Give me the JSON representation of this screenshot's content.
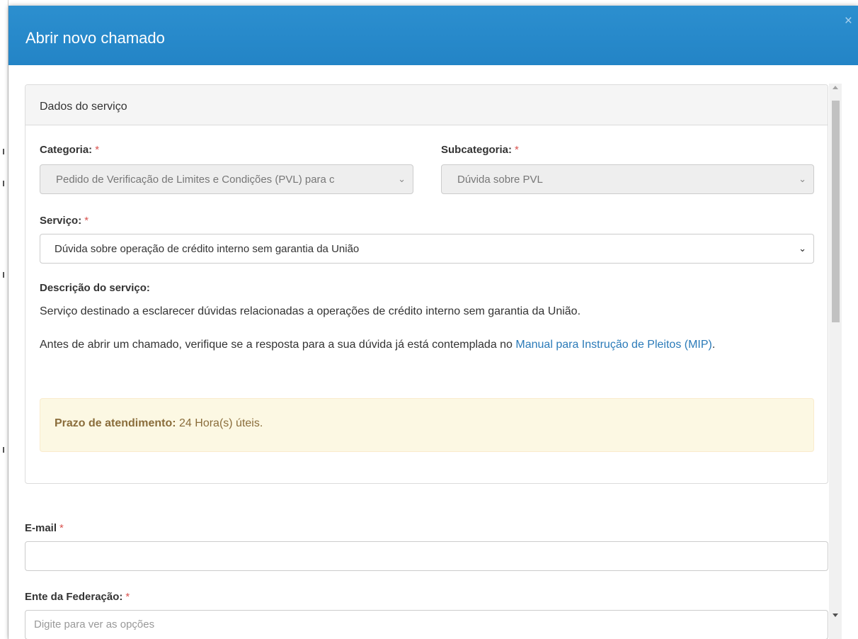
{
  "modal": {
    "title": "Abrir novo chamado",
    "close_symbol": "×"
  },
  "panel": {
    "heading": "Dados do serviço",
    "categoria": {
      "label": "Categoria:",
      "required_mark": "*",
      "value": "Pedido de Verificação de Limites e Condições (PVL) para c",
      "disabled": true
    },
    "subcategoria": {
      "label": "Subcategoria:",
      "required_mark": "*",
      "value": "Dúvida sobre PVL",
      "disabled": true
    },
    "servico": {
      "label": "Serviço:",
      "required_mark": "*",
      "value": "Dúvida sobre operação de crédito interno sem garantia da União"
    },
    "descricao": {
      "label": "Descrição do serviço:",
      "text": "Serviço destinado a esclarecer dúvidas relacionadas a operações de crédito interno sem garantia da União.",
      "note_before_link": "Antes de abrir um chamado, verifique se a resposta para a sua dúvida já está contemplada no ",
      "link_text": "Manual para Instrução de Pleitos (MIP)",
      "note_after_link": "."
    },
    "prazo": {
      "label": "Prazo de atendimento:",
      "value": "24 Hora(s) úteis."
    }
  },
  "email": {
    "label": "E-mail",
    "required_mark": "*",
    "value": ""
  },
  "ente": {
    "label": "Ente da Federação:",
    "required_mark": "*",
    "placeholder": "Digite para ver as opções"
  },
  "icons": {
    "close": "close-icon",
    "select_caret": "chevron-down-icon",
    "scroll_up": "scroll-up-arrow-icon",
    "scroll_down": "scroll-down-arrow-icon"
  },
  "colors": {
    "header": "#2384c6",
    "required": "#d9534f",
    "link": "#2a7ab8",
    "alert_bg": "#fcf8e3",
    "alert_text": "#8a6d3b"
  }
}
